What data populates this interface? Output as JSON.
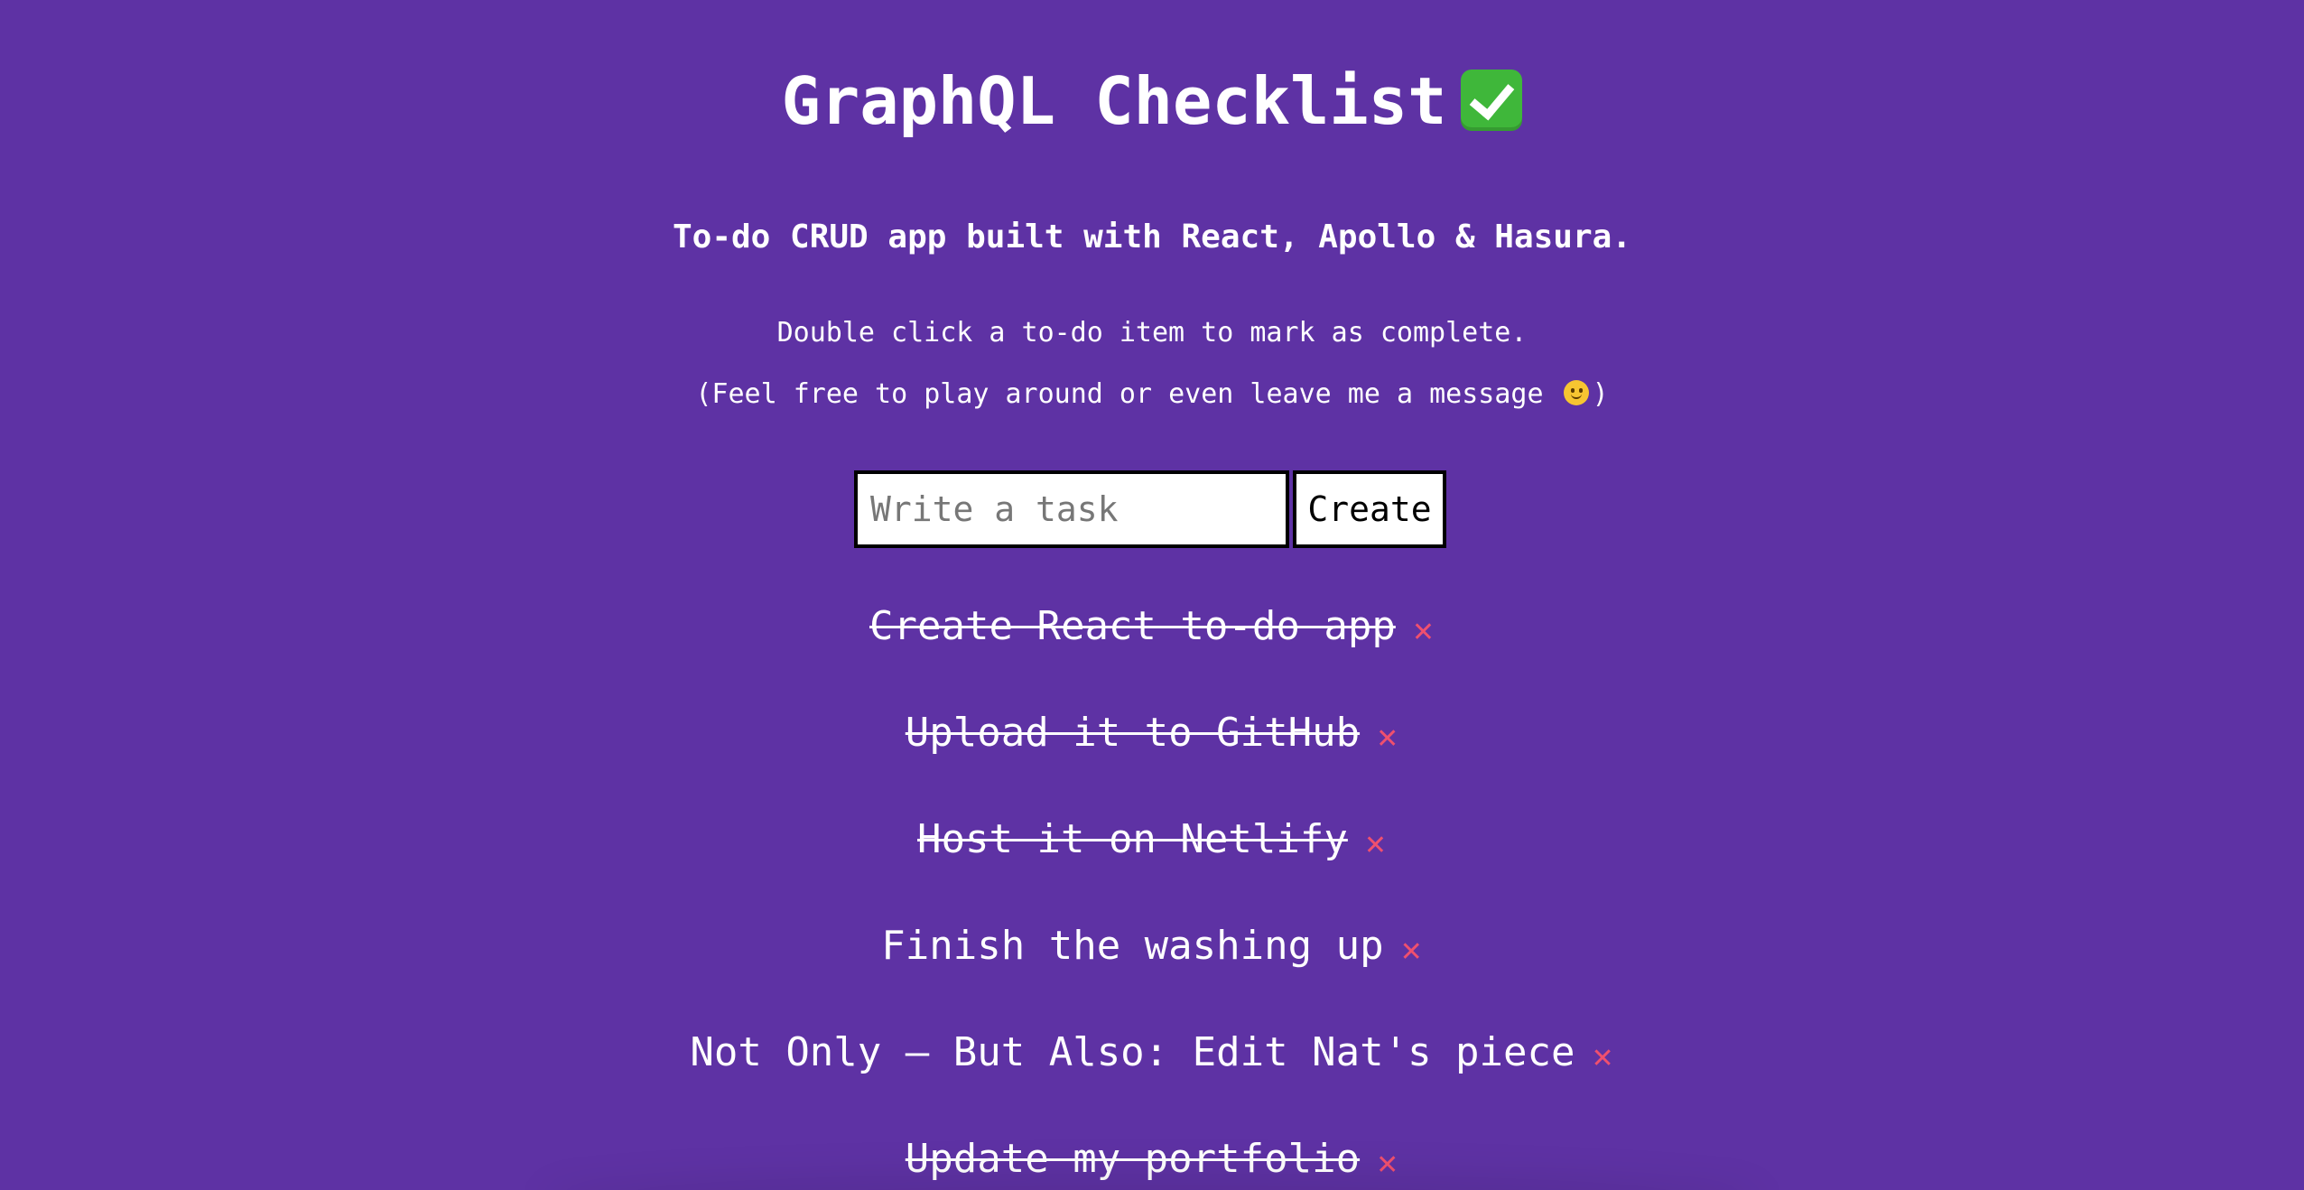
{
  "header": {
    "title": "GraphQL Checklist",
    "title_icon": "white-heavy-check-mark-icon",
    "subtitle": "To-do CRUD app built with React, Apollo & Hasura.",
    "hint_line1": "Double click a to-do item to mark as complete.",
    "hint_line2_before": "(Feel free to play around or even leave me a message",
    "hint_line2_after": ")",
    "hint_icon": "slightly-smiling-face-icon"
  },
  "form": {
    "input_value": "",
    "input_placeholder": "Write a task",
    "create_label": "Create"
  },
  "todos": [
    {
      "text": "Create React to-do app",
      "completed": true
    },
    {
      "text": "Upload it to GitHub",
      "completed": true
    },
    {
      "text": "Host it on Netlify",
      "completed": true
    },
    {
      "text": "Finish the washing up",
      "completed": false
    },
    {
      "text": "Not Only — But Also: Edit Nat's piece",
      "completed": false
    },
    {
      "text": "Update my portfolio",
      "completed": true
    }
  ],
  "delete_symbol": "✕",
  "colors": {
    "background": "#5e32a4",
    "text": "#ffffff",
    "delete": "#f0506e",
    "check_badge": "#3fb73a"
  }
}
